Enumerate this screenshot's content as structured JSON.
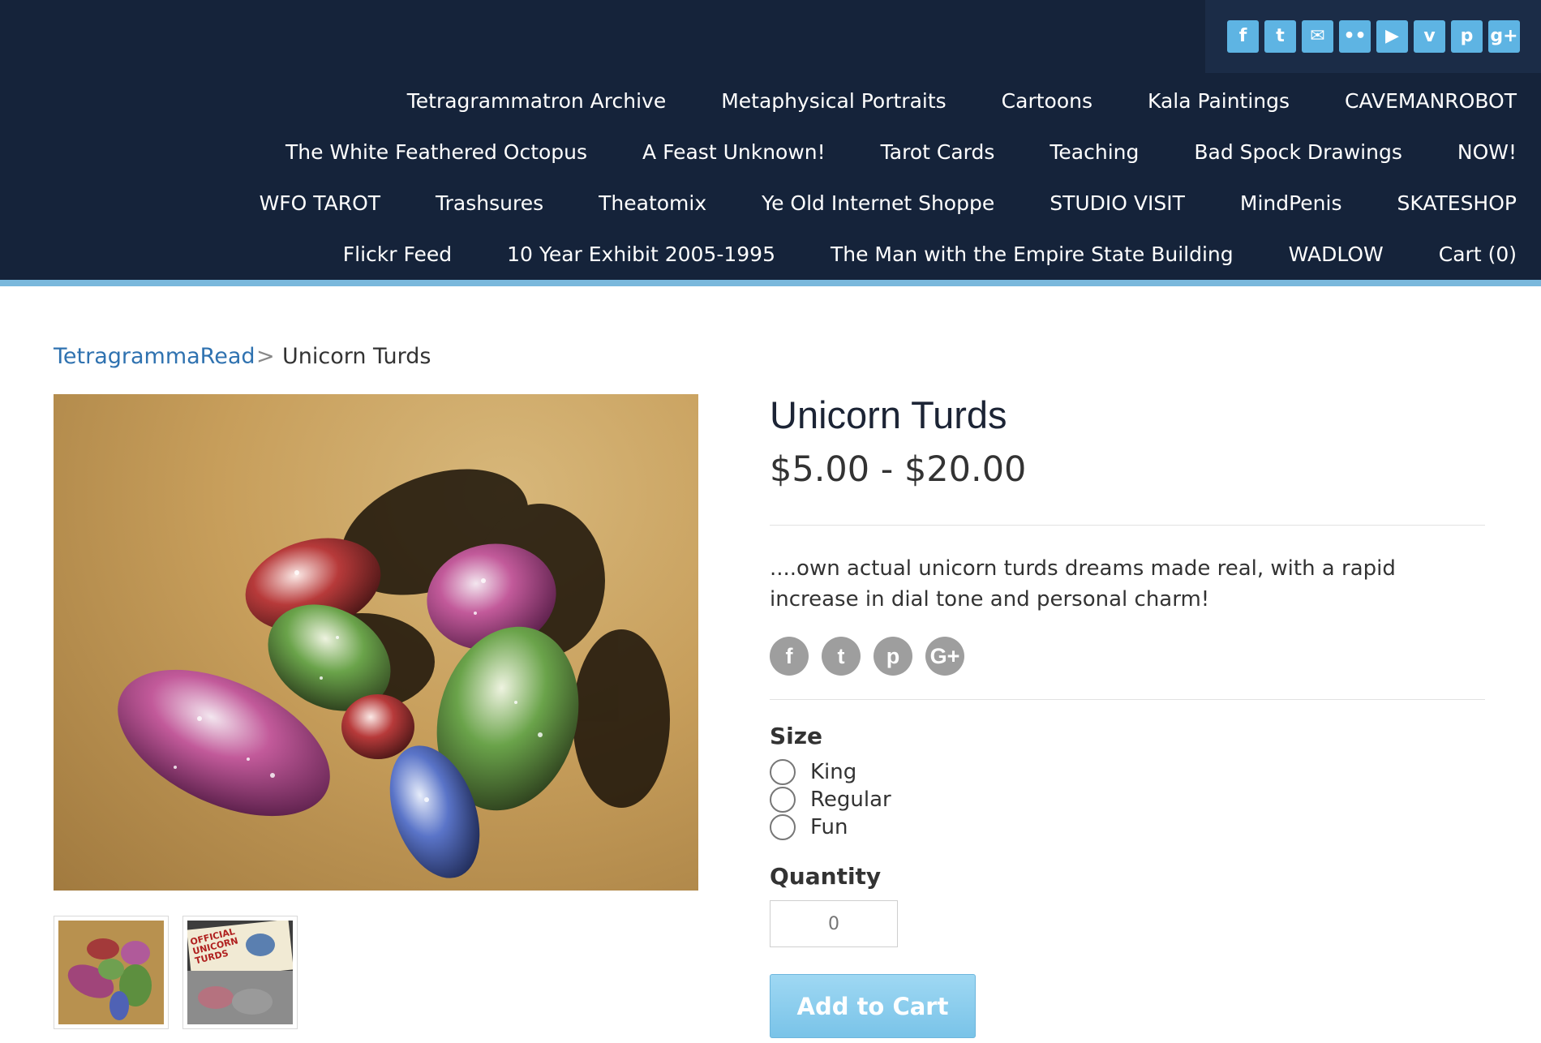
{
  "social": {
    "icons": [
      {
        "name": "facebook-icon",
        "glyph": "f"
      },
      {
        "name": "twitter-icon",
        "glyph": "t"
      },
      {
        "name": "email-icon",
        "glyph": "✉"
      },
      {
        "name": "flickr-icon",
        "glyph": "••"
      },
      {
        "name": "youtube-icon",
        "glyph": "▶"
      },
      {
        "name": "vimeo-icon",
        "glyph": "v"
      },
      {
        "name": "pinterest-icon",
        "glyph": "p"
      },
      {
        "name": "googleplus-icon",
        "glyph": "g+"
      }
    ],
    "color": "#5eb4e3"
  },
  "nav": {
    "row1": [
      "Tetragrammatron Archive",
      "Metaphysical Portraits",
      "Cartoons",
      "Kala Paintings",
      "CAVEMANROBOT"
    ],
    "row2": [
      "The White Feathered Octopus",
      "A Feast Unknown!",
      "Tarot Cards",
      "Teaching",
      "Bad Spock Drawings",
      "NOW!"
    ],
    "row3": [
      "WFO TAROT",
      "Trashsures",
      "Theatomix",
      "Ye Old Internet Shoppe",
      "STUDIO VISIT",
      "MindPenis",
      "SKATESHOP"
    ],
    "row4": [
      "Flickr Feed",
      "10 Year Exhibit 2005-1995",
      "The Man with the Empire State Building",
      "WADLOW",
      "Cart (0)"
    ]
  },
  "breadcrumb": {
    "parent": "TetragrammaRead",
    "separator": ">",
    "current": "Unicorn Turds"
  },
  "product": {
    "title": "Unicorn Turds",
    "price": "$5.00 - $20.00",
    "description": "....own actual unicorn turds dreams made real, with a rapid increase in dial tone and personal charm!",
    "share_icons": [
      {
        "name": "share-facebook-icon",
        "glyph": "f"
      },
      {
        "name": "share-twitter-icon",
        "glyph": "t"
      },
      {
        "name": "share-pinterest-icon",
        "glyph": "p"
      },
      {
        "name": "share-googleplus-icon",
        "glyph": "G+"
      }
    ],
    "size_label": "Size",
    "size_options": [
      "King",
      "Regular",
      "Fun"
    ],
    "quantity_label": "Quantity",
    "quantity_placeholder": "0",
    "add_to_cart": "Add to Cart",
    "thumb_label_lines": [
      "OFFICIAL",
      "UNICORN",
      "TURDS"
    ]
  },
  "colors": {
    "header_bg": "#15233a",
    "accent": "#7ab8dc",
    "link": "#2f72b0",
    "button": "#79c3e8"
  }
}
